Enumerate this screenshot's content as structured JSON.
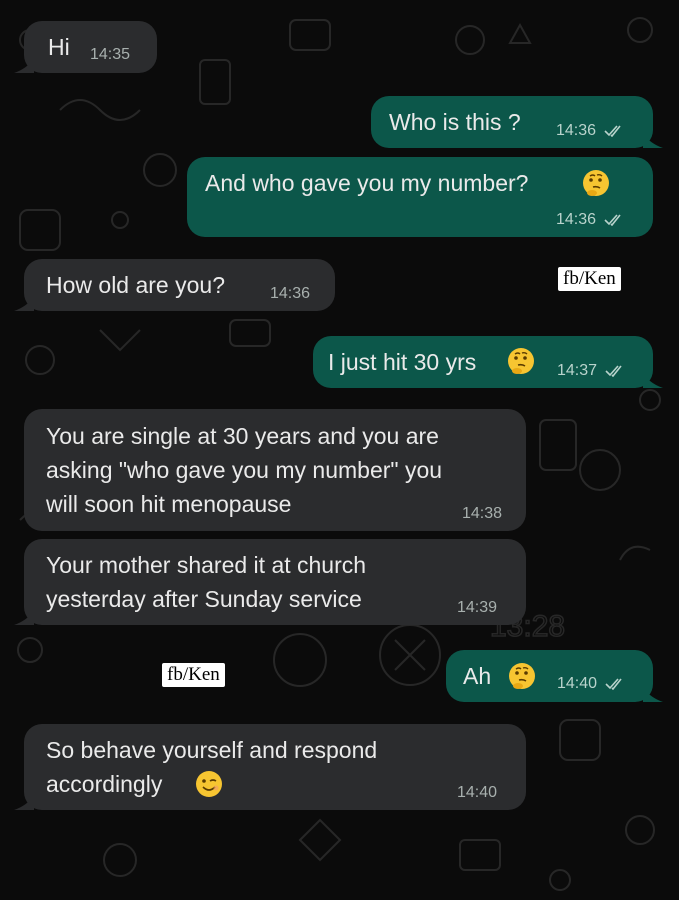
{
  "messages": [
    {
      "id": "m1",
      "dir": "in",
      "text": "Hi",
      "time": "14:35"
    },
    {
      "id": "m2",
      "dir": "out",
      "text": "Who is this ?",
      "time": "14:36"
    },
    {
      "id": "m3",
      "dir": "out",
      "text": "And who gave you my number?",
      "time": "14:36"
    },
    {
      "id": "m4",
      "dir": "in",
      "text": "How old are you?",
      "time": "14:36"
    },
    {
      "id": "m5",
      "dir": "out",
      "text": "I just hit 30 yrs",
      "time": "14:37"
    },
    {
      "id": "m6",
      "dir": "in",
      "text": "You are single at 30 years and you are\nasking \"who gave you my number\" you\nwill soon hit menopause",
      "time": "14:38"
    },
    {
      "id": "m7",
      "dir": "in",
      "text": "Your mother shared it at church\nyesterday after Sunday service",
      "time": "14:39"
    },
    {
      "id": "m8",
      "dir": "out",
      "text": "Ah",
      "time": "14:40"
    },
    {
      "id": "m9",
      "dir": "in",
      "text": "So behave yourself and respond\naccordingly",
      "time": "14:40"
    }
  ],
  "watermarks": [
    "fb/Ken",
    "fb/Ken"
  ],
  "background_time_text": "13:28",
  "colors": {
    "background": "#0b0b0b",
    "incoming_bubble": "#2b2c2e",
    "outgoing_bubble": "#0c574a",
    "text": "#eaeaea",
    "read_ticks": "#b9d3cc"
  },
  "icons": {
    "emoji_thinking": "thinking-face-emoji",
    "emoji_wink": "winking-face-emoji",
    "read_receipt": "double-check-icon"
  }
}
